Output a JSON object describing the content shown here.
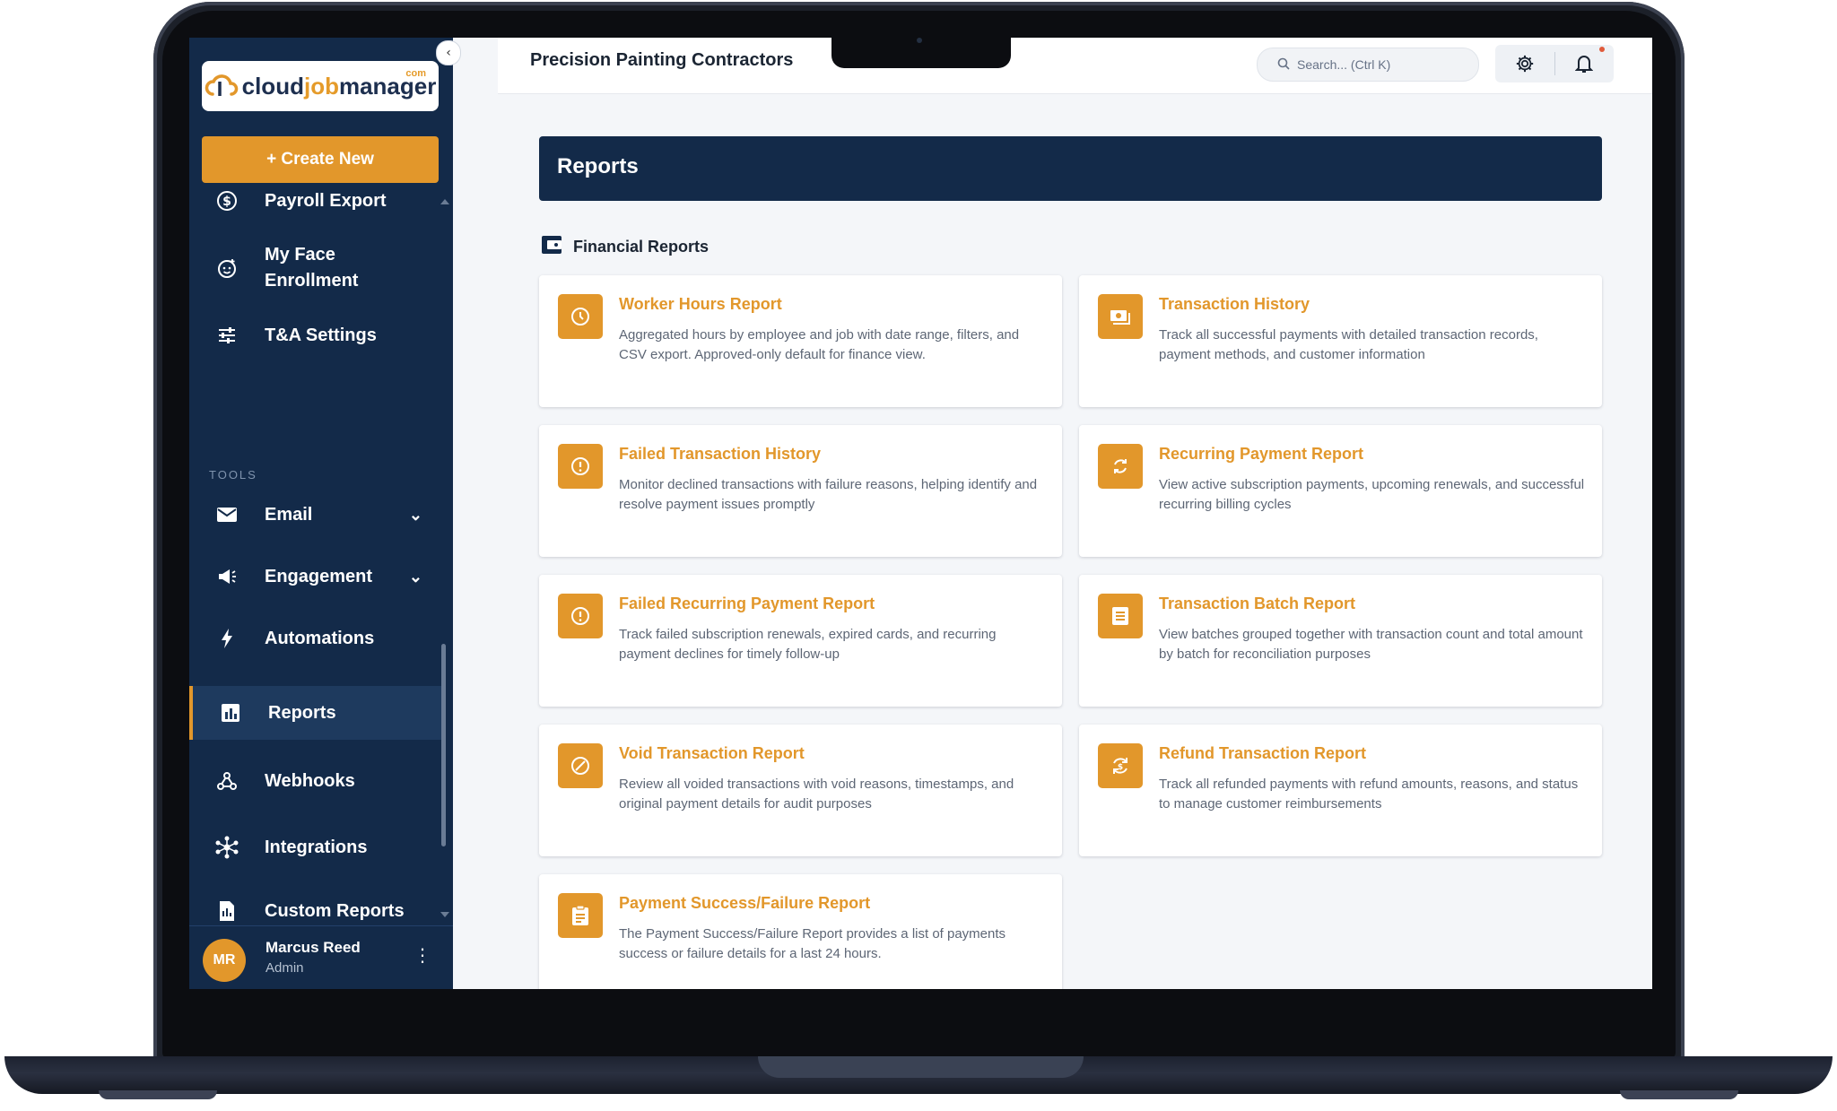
{
  "app": {
    "logo": {
      "part1": "cloud",
      "part2": "job",
      "part3": "manager",
      "suffix": "com"
    },
    "company_name": "Precision Painting Contractors"
  },
  "sidebar": {
    "create_label": "+ Create New",
    "items_top": [
      {
        "label": "Payroll Export",
        "icon": "dollar-circle-icon"
      },
      {
        "label": "My Face\nEnrollment",
        "icon": "face-scan-icon"
      },
      {
        "label": "T&A Settings",
        "icon": "sliders-icon"
      }
    ],
    "tools_label": "TOOLS",
    "tools": [
      {
        "label": "Email",
        "icon": "mail-icon",
        "expandable": true
      },
      {
        "label": "Engagement",
        "icon": "megaphone-icon",
        "expandable": true
      },
      {
        "label": "Automations",
        "icon": "lightning-icon",
        "expandable": false
      },
      {
        "label": "Reports",
        "icon": "bar-chart-icon",
        "active": true
      },
      {
        "label": "Webhooks",
        "icon": "webhook-icon"
      },
      {
        "label": "Integrations",
        "icon": "integrations-icon"
      },
      {
        "label": "Custom Reports",
        "icon": "document-icon"
      }
    ],
    "user": {
      "initials": "MR",
      "name": "Marcus Reed",
      "role": "Admin"
    }
  },
  "topbar": {
    "search_placeholder": "Search... (Ctrl K)"
  },
  "main": {
    "page_title": "Reports",
    "section_title": "Financial Reports",
    "cards": [
      {
        "title": "Worker Hours Report",
        "desc": "Aggregated hours by employee and job with date range, filters, and CSV export. Approved-only default for finance view.",
        "icon": "clock-icon"
      },
      {
        "title": "Transaction History",
        "desc": "Track all successful payments with detailed transaction records, payment methods, and customer information",
        "icon": "cash-icon"
      },
      {
        "title": "Failed Transaction History",
        "desc": "Monitor declined transactions with failure reasons, helping identify and resolve payment issues promptly",
        "icon": "alert-circle-icon"
      },
      {
        "title": "Recurring Payment Report",
        "desc": "View active subscription payments, upcoming renewals, and successful recurring billing cycles",
        "icon": "refresh-icon"
      },
      {
        "title": "Failed Recurring Payment Report",
        "desc": "Track failed subscription renewals, expired cards, and recurring payment declines for timely follow-up",
        "icon": "alert-circle-icon"
      },
      {
        "title": "Transaction Batch Report",
        "desc": "View batches grouped together with transaction count and total amount by batch for reconciliation purposes",
        "icon": "list-doc-icon"
      },
      {
        "title": "Void Transaction Report",
        "desc": "Review all voided transactions with void reasons, timestamps, and original payment details for audit purposes",
        "icon": "void-icon"
      },
      {
        "title": "Refund Transaction Report",
        "desc": "Track all refunded payments with refund amounts, reasons, and status to manage customer reimbursements",
        "icon": "refund-icon"
      },
      {
        "title": "Payment Success/Failure Report",
        "desc": "The Payment Success/Failure Report provides a list of payments success or failure details for a last 24 hours.",
        "icon": "clipboard-icon"
      }
    ]
  },
  "colors": {
    "accent": "#e2972b",
    "navy": "#132a49",
    "background": "#f4f6f9"
  }
}
